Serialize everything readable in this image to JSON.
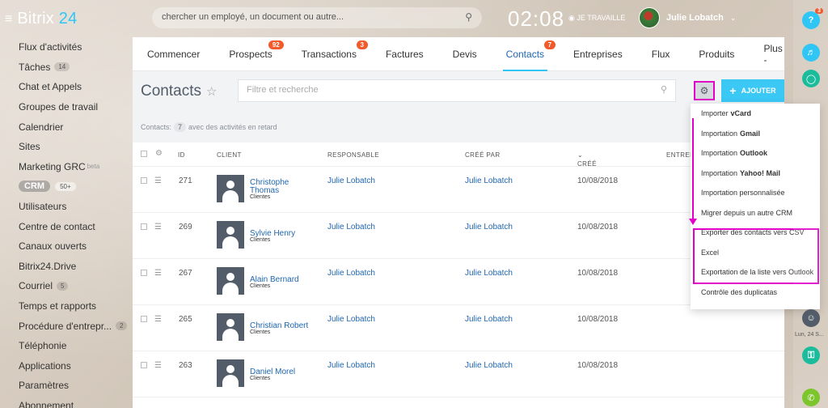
{
  "header": {
    "brand_main": "Bitrix",
    "brand_num": "24",
    "search_placeholder": "chercher un employé, un document ou autre...",
    "time": "02:08",
    "work_status": "JE TRAVAILLE",
    "user_name": "Julie Lobatch"
  },
  "sidebar": {
    "items": [
      {
        "label": "Flux d'activités"
      },
      {
        "label": "Tâches",
        "count": "14"
      },
      {
        "label": "Chat et Appels"
      },
      {
        "label": "Groupes de travail"
      },
      {
        "label": "Calendrier"
      },
      {
        "label": "Sites"
      },
      {
        "label": "Marketing GRC",
        "beta": "beta"
      },
      {
        "label": "CRM",
        "count": "50+",
        "pill": true
      },
      {
        "label": "Utilisateurs"
      },
      {
        "label": "Centre de contact"
      },
      {
        "label": "Canaux ouverts"
      },
      {
        "label": "Bitrix24.Drive"
      },
      {
        "label": "Courriel",
        "count": "5"
      },
      {
        "label": "Temps et rapports"
      },
      {
        "label": "Procédure d'entrepr...",
        "count": "2"
      },
      {
        "label": "Téléphonie"
      },
      {
        "label": "Applications"
      },
      {
        "label": "Paramètres"
      },
      {
        "label": "Abonnement"
      }
    ]
  },
  "tabs": [
    {
      "label": "Commencer"
    },
    {
      "label": "Prospects",
      "badge": "92"
    },
    {
      "label": "Transactions",
      "badge": "3"
    },
    {
      "label": "Factures"
    },
    {
      "label": "Devis"
    },
    {
      "label": "Contacts",
      "badge": "7",
      "active": true
    },
    {
      "label": "Entreprises"
    },
    {
      "label": "Flux"
    },
    {
      "label": "Produits"
    },
    {
      "label": "Plus -"
    }
  ],
  "page": {
    "title": "Contacts",
    "filter_placeholder": "Filtre et recherche",
    "add_label": "AJOUTER",
    "counter_label": "Contacts:",
    "counter_value": "7",
    "counter_suffix": "avec des activités en retard"
  },
  "grid": {
    "columns": {
      "id": "ID",
      "client": "CLIENT",
      "responsable": "RESPONSABLE",
      "cree_par": "CRÉÉ PAR",
      "cree": "CRÉÉ",
      "entreprise": "ENTREPR"
    },
    "rows": [
      {
        "id": "271",
        "name1": "Christophe",
        "name2": "Thomas",
        "type": "Clientes",
        "responsable": "Julie Lobatch",
        "cree_par": "Julie Lobatch",
        "date": "10/08/2018"
      },
      {
        "id": "269",
        "name1": "Sylvie Henry",
        "name2": "",
        "type": "Clientes",
        "responsable": "Julie Lobatch",
        "cree_par": "Julie Lobatch",
        "date": "10/08/2018"
      },
      {
        "id": "267",
        "name1": "Alain Bernard",
        "name2": "",
        "type": "Clientes",
        "responsable": "Julie Lobatch",
        "cree_par": "Julie Lobatch",
        "date": "10/08/2018"
      },
      {
        "id": "265",
        "name1": "Christian Robert",
        "name2": "",
        "type": "Clientes",
        "responsable": "Julie Lobatch",
        "cree_par": "Julie Lobatch",
        "date": "10/08/2018"
      },
      {
        "id": "263",
        "name1": "Daniel Morel",
        "name2": "",
        "type": "Clientes",
        "responsable": "Julie Lobatch",
        "cree_par": "Julie Lobatch",
        "date": "10/08/2018"
      }
    ]
  },
  "dropdown": {
    "options": [
      {
        "pre": "Importer",
        "bold": "vCard"
      },
      {
        "pre": "Importation",
        "bold": "Gmail"
      },
      {
        "pre": "Importation",
        "bold": "Outlook"
      },
      {
        "pre": "Importation",
        "bold": "Yahoo! Mail"
      },
      {
        "pre": "Importation personnalisée",
        "bold": ""
      },
      {
        "pre": "Migrer depuis un autre CRM",
        "bold": ""
      },
      {
        "pre": "Exporter des contacts vers CSV",
        "bold": ""
      },
      {
        "pre": "Excel",
        "bold": ""
      },
      {
        "pre": "Exportation de la liste vers Outlook",
        "bold": ""
      },
      {
        "pre": "Contrôle des duplicatas",
        "bold": ""
      }
    ]
  },
  "rail": {
    "help_badge": "3",
    "date_label": "Lun, 24 S..."
  },
  "colors": {
    "accent": "#2fc6f6",
    "link": "#2067b0",
    "badge": "#f15a2b",
    "highlight": "#e000c8"
  }
}
